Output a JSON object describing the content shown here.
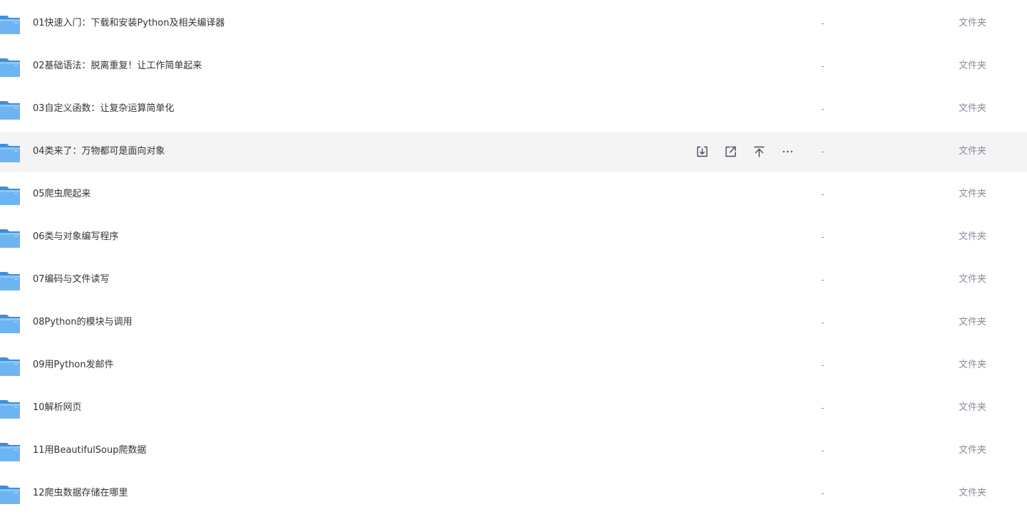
{
  "file_list": {
    "rows": [
      {
        "name": "01快速入门：下载和安装Python及相关编译器",
        "size": "-",
        "type": "文件夹"
      },
      {
        "name": "02基础语法：脱离重复！让工作简单起来",
        "size": "-",
        "type": "文件夹"
      },
      {
        "name": "03自定义函数：让复杂运算简单化",
        "size": "-",
        "type": "文件夹"
      },
      {
        "name": "04类来了：万物都可是面向对象",
        "size": "-",
        "type": "文件夹"
      },
      {
        "name": "05爬虫爬起来",
        "size": "-",
        "type": "文件夹"
      },
      {
        "name": "06类与对象编写程序",
        "size": "-",
        "type": "文件夹"
      },
      {
        "name": "07编码与文件读写",
        "size": "-",
        "type": "文件夹"
      },
      {
        "name": "08Python的模块与调用",
        "size": "-",
        "type": "文件夹"
      },
      {
        "name": "09用Python发邮件",
        "size": "-",
        "type": "文件夹"
      },
      {
        "name": "10解析网页",
        "size": "-",
        "type": "文件夹"
      },
      {
        "name": "11用BeautifulSoup爬数据",
        "size": "-",
        "type": "文件夹"
      },
      {
        "name": "12爬虫数据存储在哪里",
        "size": "-",
        "type": "文件夹"
      }
    ],
    "hovered_row_index": 3,
    "row_icon": "folder-icon",
    "row_actions": [
      {
        "icon": "download-icon"
      },
      {
        "icon": "share-icon"
      },
      {
        "icon": "move-to-top-icon"
      },
      {
        "icon": "more-icon"
      }
    ]
  },
  "colors": {
    "hover_background": "#f4f4f5",
    "folder_blue": "#5aa9f0",
    "text_primary": "#333333",
    "text_secondary": "#878c9c"
  }
}
